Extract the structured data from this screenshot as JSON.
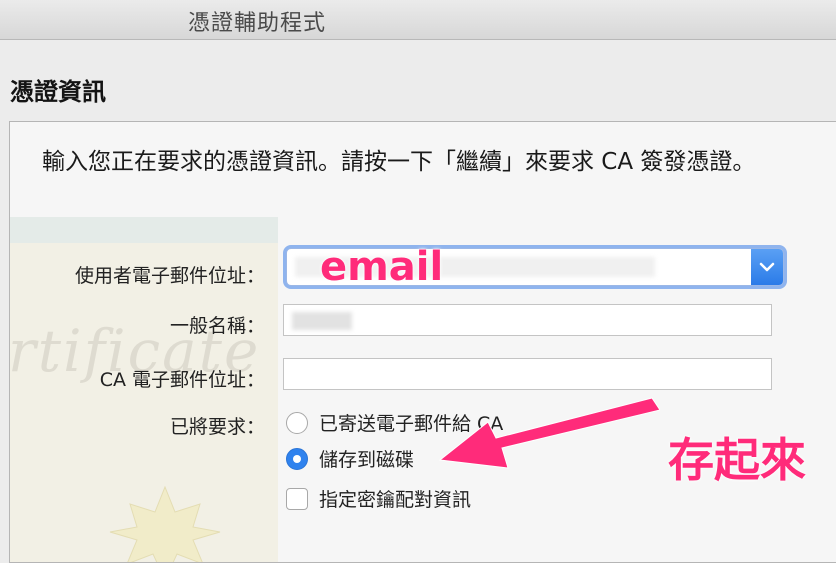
{
  "window": {
    "title": "憑證輔助程式"
  },
  "section": {
    "title": "憑證資訊"
  },
  "intro": {
    "text": "輸入您正在要求的憑證資訊。請按一下「繼續」來要求 CA 簽發憑證。"
  },
  "form": {
    "email_label": "使用者電子郵件位址：",
    "common_name_label": "一般名稱：",
    "ca_email_label": "CA 電子郵件位址：",
    "request_label": "已將要求：",
    "options": {
      "emailed": "已寄送電子郵件給 CA",
      "saved": "儲存到磁碟",
      "keypair": "指定密鑰配對資訊"
    },
    "selected_option": "saved",
    "keypair_checked": false
  },
  "annotations": {
    "email": "email",
    "save": "存起來",
    "color": "#ff2b7a"
  },
  "colors": {
    "accent": "#2f82ee"
  },
  "icons": {
    "combo": "chevron-down-icon",
    "watermark": "certificate-seal-icon"
  }
}
